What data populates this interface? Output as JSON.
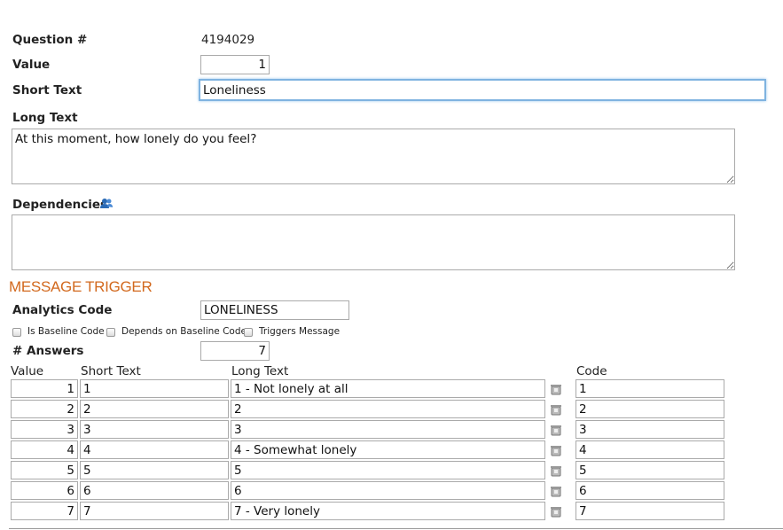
{
  "question": {
    "number_label": "Question #",
    "number_value": "4194029",
    "value_label": "Value",
    "value": "1",
    "short_text_label": "Short Text",
    "short_text": "Loneliness",
    "long_text_label": "Long Text",
    "long_text": "At this moment, how lonely do you feel?",
    "dependencies_label": "Dependencies",
    "dependencies": ""
  },
  "trigger": {
    "section_title": "MESSAGE TRIGGER",
    "analytics_label": "Analytics Code",
    "analytics_code": "LONELINESS",
    "checkboxes": [
      {
        "label": "Is Baseline Code",
        "checked": false
      },
      {
        "label": "Depends on Baseline Code",
        "checked": false
      },
      {
        "label": "Triggers Message",
        "checked": false
      }
    ],
    "answers_label": "# Answers",
    "answers_count": "7"
  },
  "answers": {
    "headers": {
      "value": "Value",
      "short_text": "Short Text",
      "long_text": "Long Text",
      "code": "Code"
    },
    "rows": [
      {
        "value": "1",
        "short": "1",
        "long": "1 - Not lonely at all",
        "code": "1"
      },
      {
        "value": "2",
        "short": "2",
        "long": "2",
        "code": "2"
      },
      {
        "value": "3",
        "short": "3",
        "long": "3",
        "code": "3"
      },
      {
        "value": "4",
        "short": "4",
        "long": "4 - Somewhat lonely",
        "code": "4"
      },
      {
        "value": "5",
        "short": "5",
        "long": "5",
        "code": "5"
      },
      {
        "value": "6",
        "short": "6",
        "long": "6",
        "code": "6"
      },
      {
        "value": "7",
        "short": "7",
        "long": "7 - Very lonely",
        "code": "7"
      }
    ]
  },
  "icons": {
    "dependencies": "users-icon",
    "row_action": "trash-icon"
  },
  "colors": {
    "section_title": "#d2691e",
    "focus": "#7fb3e0",
    "dependencies_icon": "#2a6ab5"
  }
}
